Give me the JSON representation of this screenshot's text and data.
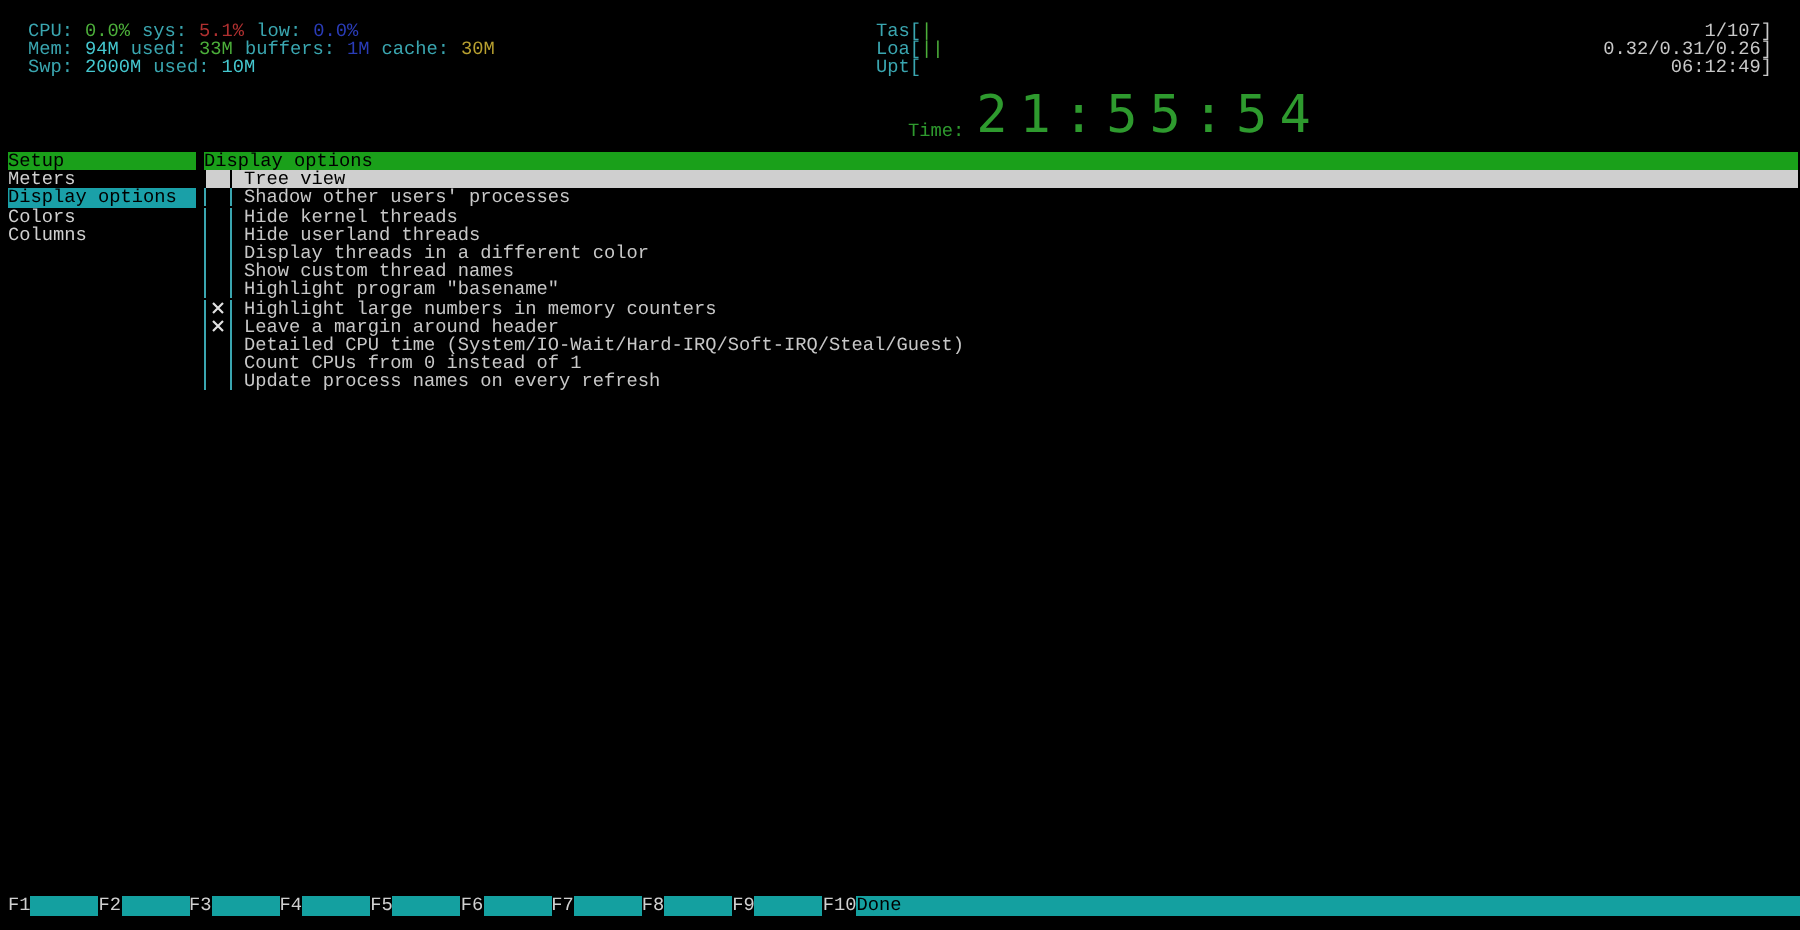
{
  "header": {
    "left_meters": [
      [
        {
          "text": "CPU:",
          "color": "#3aa6b0"
        },
        {
          "text": "0.0%",
          "color": "#4caf3a"
        },
        {
          "text": "sys:",
          "color": "#3aa6b0"
        },
        {
          "text": "5.1%",
          "color": "#b03030"
        },
        {
          "text": "low:",
          "color": "#3aa6b0"
        },
        {
          "text": "0.0%",
          "color": "#2a3cb8"
        }
      ],
      [
        {
          "text": "Mem:",
          "color": "#3aa6b0"
        },
        {
          "text": "94M",
          "color": "#45c8d0"
        },
        {
          "text": "used:",
          "color": "#3aa6b0"
        },
        {
          "text": "33M",
          "color": "#4caf3a"
        },
        {
          "text": "buffers:",
          "color": "#3aa6b0"
        },
        {
          "text": "1M",
          "color": "#2a3cb8"
        },
        {
          "text": "cache:",
          "color": "#3aa6b0"
        },
        {
          "text": "30M",
          "color": "#b8a030"
        }
      ],
      [
        {
          "text": "Swp:",
          "color": "#3aa6b0"
        },
        {
          "text": "2000M",
          "color": "#45c8d0"
        },
        {
          "text": "used:",
          "color": "#3aa6b0"
        },
        {
          "text": "10M",
          "color": "#45c8d0"
        }
      ]
    ],
    "right_meters": [
      {
        "label": "Tas[",
        "bar": "|",
        "value": "1/107]"
      },
      {
        "label": "Loa[",
        "bar": "||",
        "value": "0.32/0.31/0.26]"
      },
      {
        "label": "Upt[",
        "value": "06:12:49]"
      }
    ],
    "clock": {
      "label": "Time:",
      "value": "21:55:54"
    }
  },
  "sidebar": {
    "title": "Setup",
    "items": [
      {
        "label": "Meters",
        "selected": false
      },
      {
        "label": "Display options",
        "selected": true
      },
      {
        "label": "Colors",
        "selected": false
      },
      {
        "label": "Columns",
        "selected": false
      }
    ]
  },
  "options": {
    "title": "Display options",
    "items": [
      {
        "label": "Tree view",
        "checked": false,
        "selected": true
      },
      {
        "label": "Shadow other users' processes",
        "checked": false,
        "selected": false
      },
      {
        "label": "Hide kernel threads",
        "checked": false,
        "selected": false
      },
      {
        "label": "Hide userland threads",
        "checked": false,
        "selected": false
      },
      {
        "label": "Display threads in a different color",
        "checked": false,
        "selected": false
      },
      {
        "label": "Show custom thread names",
        "checked": false,
        "selected": false
      },
      {
        "label": "Highlight program \"basename\"",
        "checked": false,
        "selected": false
      },
      {
        "label": "Highlight large numbers in memory counters",
        "checked": true,
        "selected": false
      },
      {
        "label": "Leave a margin around header",
        "checked": true,
        "selected": false
      },
      {
        "label": "Detailed CPU time (System/IO-Wait/Hard-IRQ/Soft-IRQ/Steal/Guest)",
        "checked": false,
        "selected": false
      },
      {
        "label": "Count CPUs from 0 instead of 1",
        "checked": false,
        "selected": false
      },
      {
        "label": "Update process names on every refresh",
        "checked": false,
        "selected": false
      }
    ]
  },
  "function_bar": [
    {
      "key": "F1"
    },
    {
      "key": "F2"
    },
    {
      "key": "F3"
    },
    {
      "key": "F4"
    },
    {
      "key": "F5"
    },
    {
      "key": "F6"
    },
    {
      "key": "F7"
    },
    {
      "key": "F8"
    },
    {
      "key": "F9"
    },
    {
      "key": "F10",
      "label": "Done"
    }
  ]
}
